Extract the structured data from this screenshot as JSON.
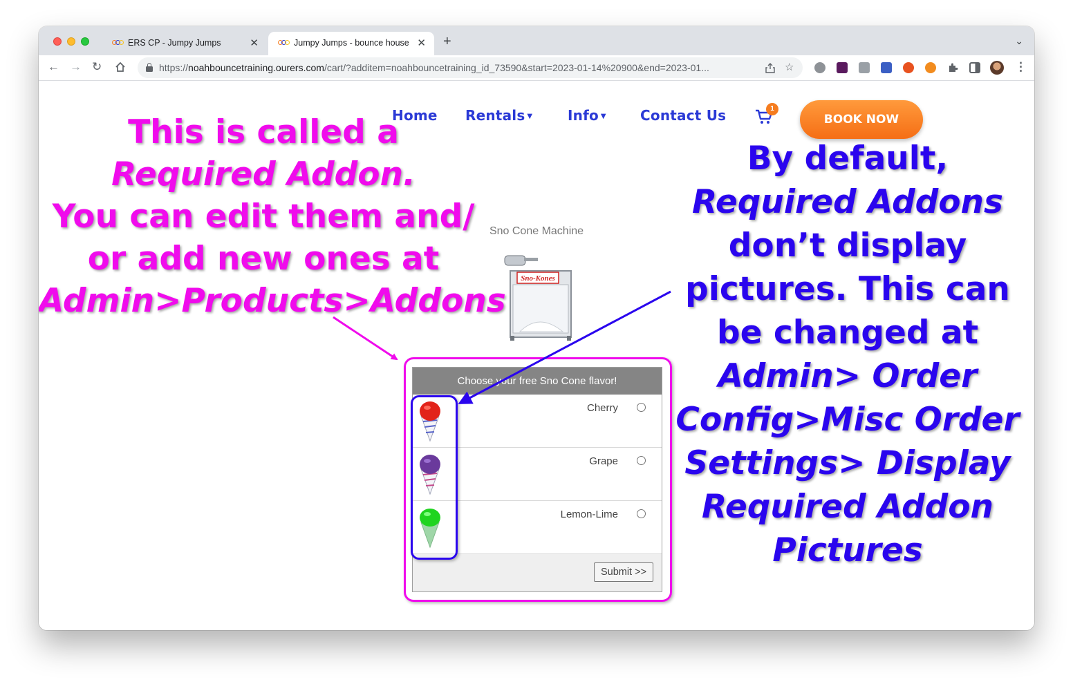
{
  "browser": {
    "tabs": [
      {
        "title": "ERS CP - Jumpy Jumps",
        "close": "✕"
      },
      {
        "title": "Jumpy Jumps - bounce house",
        "close": "✕"
      }
    ],
    "new_tab": "+",
    "tab_menu": "⌄",
    "url_prefix": "https://",
    "url_host": "noahbouncetraining.ourers.com",
    "url_path": "/cart/?additem=noahbouncetraining_id_73590&start=2023-01-14%20900&end=2023-01..."
  },
  "site_nav": {
    "home": "Home",
    "rentals": "Rentals",
    "info": "Info",
    "contact": "Contact Us",
    "cart_count": "1",
    "book_now": "BOOK NOW"
  },
  "product": {
    "title": "Sno Cone Machine",
    "machine_sign": "Sno-Kones"
  },
  "addon": {
    "header": "Choose your free Sno Cone flavor!",
    "options": [
      {
        "label": "Cherry",
        "color": "#e2231a"
      },
      {
        "label": "Grape",
        "color": "#6a3a9c"
      },
      {
        "label": "Lemon-Lime",
        "color": "#1fd41f"
      }
    ],
    "submit": "Submit >>"
  },
  "annotations": {
    "left": {
      "line1": "This is called a",
      "line2": "Required Addon.",
      "line3": "You can edit them and/",
      "line4": "or add new ones at",
      "line5": "Admin>Products>Addons",
      "color": "#f00bec"
    },
    "right": {
      "p1": "By default, ",
      "p2": "Required Addons",
      "p3": " don’t display pictures. This can be changed at ",
      "p4": "Admin> Order Config>Misc Order Settings> Display Required Addon Pictures",
      "color": "#2a05ee"
    }
  },
  "colors": {
    "nav_text": "#2b3ad6",
    "book_now": "#f56e15"
  }
}
